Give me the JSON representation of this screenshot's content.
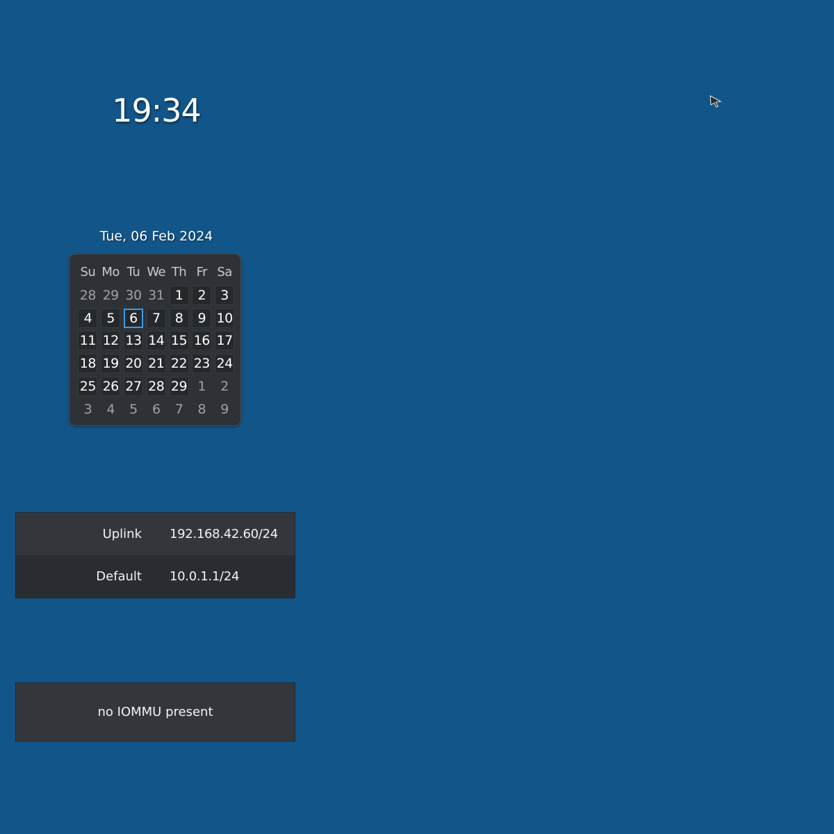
{
  "clock": {
    "time": "19:34"
  },
  "date": {
    "label": "Tue, 06 Feb 2024"
  },
  "calendar": {
    "weekdays": [
      "Su",
      "Mo",
      "Tu",
      "We",
      "Th",
      "Fr",
      "Sa"
    ],
    "weeks": [
      [
        {
          "d": "28",
          "m": "other"
        },
        {
          "d": "29",
          "m": "other"
        },
        {
          "d": "30",
          "m": "other"
        },
        {
          "d": "31",
          "m": "other"
        },
        {
          "d": "1",
          "m": "cur"
        },
        {
          "d": "2",
          "m": "cur"
        },
        {
          "d": "3",
          "m": "cur"
        }
      ],
      [
        {
          "d": "4",
          "m": "cur"
        },
        {
          "d": "5",
          "m": "cur"
        },
        {
          "d": "6",
          "m": "today"
        },
        {
          "d": "7",
          "m": "cur"
        },
        {
          "d": "8",
          "m": "cur"
        },
        {
          "d": "9",
          "m": "cur"
        },
        {
          "d": "10",
          "m": "cur"
        }
      ],
      [
        {
          "d": "11",
          "m": "cur"
        },
        {
          "d": "12",
          "m": "cur"
        },
        {
          "d": "13",
          "m": "cur"
        },
        {
          "d": "14",
          "m": "cur"
        },
        {
          "d": "15",
          "m": "cur"
        },
        {
          "d": "16",
          "m": "cur"
        },
        {
          "d": "17",
          "m": "cur"
        }
      ],
      [
        {
          "d": "18",
          "m": "cur"
        },
        {
          "d": "19",
          "m": "cur"
        },
        {
          "d": "20",
          "m": "cur"
        },
        {
          "d": "21",
          "m": "cur"
        },
        {
          "d": "22",
          "m": "cur"
        },
        {
          "d": "23",
          "m": "cur"
        },
        {
          "d": "24",
          "m": "cur"
        }
      ],
      [
        {
          "d": "25",
          "m": "cur"
        },
        {
          "d": "26",
          "m": "cur"
        },
        {
          "d": "27",
          "m": "cur"
        },
        {
          "d": "28",
          "m": "cur"
        },
        {
          "d": "29",
          "m": "cur"
        },
        {
          "d": "1",
          "m": "other"
        },
        {
          "d": "2",
          "m": "other"
        }
      ],
      [
        {
          "d": "3",
          "m": "other"
        },
        {
          "d": "4",
          "m": "other"
        },
        {
          "d": "5",
          "m": "other"
        },
        {
          "d": "6",
          "m": "other"
        },
        {
          "d": "7",
          "m": "other"
        },
        {
          "d": "8",
          "m": "other"
        },
        {
          "d": "9",
          "m": "other"
        }
      ]
    ]
  },
  "network": {
    "rows": [
      {
        "name": "Uplink",
        "address": "192.168.42.60/24"
      },
      {
        "name": "Default",
        "address": "10.0.1.1/24"
      }
    ]
  },
  "iommu": {
    "message": "no IOMMU present"
  },
  "cursor": {
    "icon": "mouse-pointer-icon"
  },
  "colors": {
    "desktop_background": "#125589",
    "panel_background": "#33373b",
    "today_highlight": "#3d9be8"
  }
}
